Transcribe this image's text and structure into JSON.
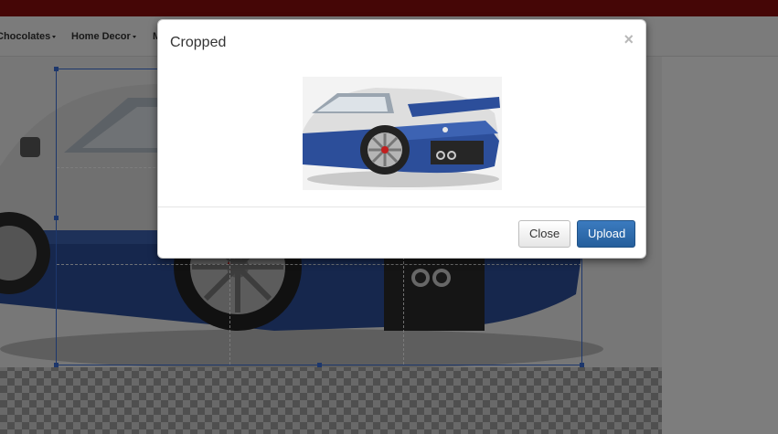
{
  "nav": {
    "items": [
      {
        "label": "Chocolates"
      },
      {
        "label": "Home Decor"
      },
      {
        "label": "M"
      }
    ]
  },
  "modal": {
    "title": "Cropped",
    "close_glyph": "×",
    "buttons": {
      "close_label": "Close",
      "upload_label": "Upload"
    }
  },
  "colors": {
    "topbar": "#8b0d0d",
    "primary_button": "#2a6aad",
    "crop_box_border": "#3a6fd8",
    "car_body_blue": "#2c4e9a",
    "car_body_silver": "#e2e2e2"
  },
  "icons": {
    "dropdown": "caret-down-icon",
    "close": "close-icon"
  }
}
